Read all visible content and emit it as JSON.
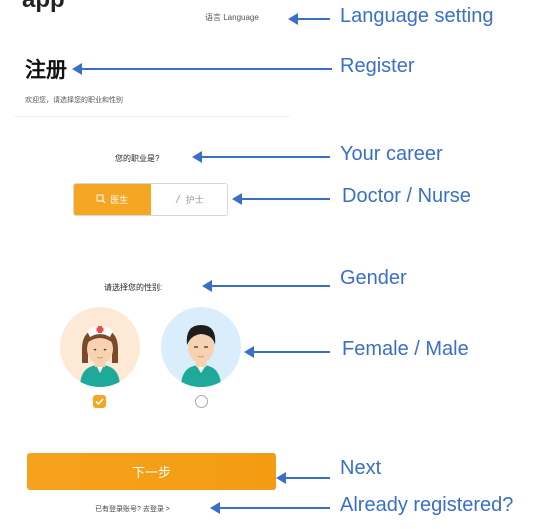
{
  "app": {
    "title": "app"
  },
  "header": {
    "language_label": "语言 Language"
  },
  "register": {
    "title": "注册",
    "welcome": "欢迎您，请选择您的职业和性别"
  },
  "career": {
    "question": "您的职业是?",
    "options": [
      {
        "label": "医生",
        "icon": "doctor-icon",
        "selected": true
      },
      {
        "label": "护士",
        "icon": "nurse-icon",
        "selected": false
      }
    ]
  },
  "gender": {
    "question": "请选择您的性别:",
    "options": [
      {
        "name": "female",
        "icon": "female-nurse-avatar",
        "selected": true
      },
      {
        "name": "male",
        "icon": "male-avatar",
        "selected": false
      }
    ]
  },
  "footer": {
    "next_label": "下一步",
    "already_registered": "已有登录账号? 去登录 >"
  },
  "annotations": {
    "language": "Language setting",
    "register": "Register",
    "career": "Your career",
    "doctor_nurse": "Doctor / Nurse",
    "gender": "Gender",
    "female_male": "Female / Male",
    "next": "Next",
    "already": "Already registered?"
  },
  "colors": {
    "accent": "#f5a623",
    "annotation": "#3a6fc8"
  }
}
